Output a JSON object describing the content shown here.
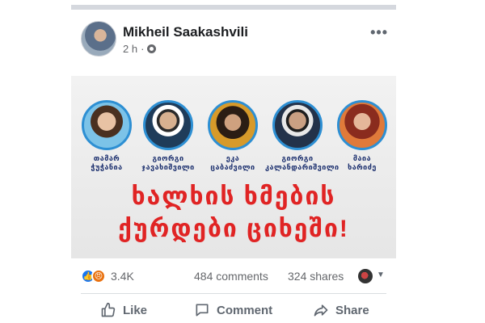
{
  "post": {
    "author": "Mikheil Saakashvili",
    "time": "2 h",
    "privacy_icon": "gear-icon",
    "more_icon": "more-options-icon"
  },
  "banner": {
    "people": [
      {
        "name_line1": "თამარ",
        "name_line2": "ჭუჭანია"
      },
      {
        "name_line1": "გიორგი",
        "name_line2": "ჯავახიშვილი"
      },
      {
        "name_line1": "ეკა",
        "name_line2": "ცაბაძვილი"
      },
      {
        "name_line1": "გიორგი",
        "name_line2": "კალანდარიშვილი"
      },
      {
        "name_line1": "მაია",
        "name_line2": "ხარიძე"
      }
    ],
    "slogan_line1": "ხალხის ხმების",
    "slogan_line2": "ქურდები ციხეში!",
    "slogan_color": "#e02424",
    "ring_color": "#2d8fd3"
  },
  "stats": {
    "reactions": "3.4K",
    "comments": "484 comments",
    "shares": "324 shares"
  },
  "actions": {
    "like": "Like",
    "comment": "Comment",
    "share": "Share"
  }
}
